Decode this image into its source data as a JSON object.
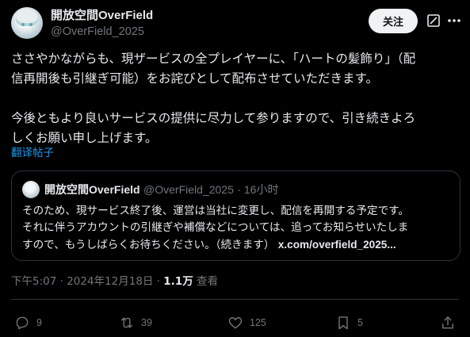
{
  "author": {
    "display_name": "開放空間OverField",
    "handle": "@OverField_2025"
  },
  "follow_label": "关注",
  "tweet": {
    "lines": [
      "ささやかながらも、現ザービスの全プレイヤーに、「ハートの髪飾り」（配",
      "信再開後も引継ぎ可能）をお詫びとして配布させていただきます。",
      "今後ともより良いサービスの提供に尽力して参りますので、引き続きよろ",
      "しくお願い申し上げます。"
    ]
  },
  "translate_label": "翻译帖子",
  "quote": {
    "display_name": "開放空間OverField",
    "handle": "@OverField_2025",
    "time": "16小时",
    "lines": [
      "そのため、現サービス終了後、運営は当社に変更し、配信を再開する予定です。",
      "それに伴うアカウントの引継ぎや補償などについては、追ってお知らせいたしま",
      "すので、もうしばらくお待ちください。（続きます）"
    ],
    "link": "x.com/overfield_2025..."
  },
  "timestamp": {
    "time": "下午5:07 · 2024年12月18日 · ",
    "views": "1.1万",
    "views_label": " 查看"
  },
  "actions": {
    "replies": "9",
    "reposts": "39",
    "likes": "125",
    "bookmarks": "5"
  },
  "icons": [
    "grok-icon",
    "more-icon",
    "reply-icon",
    "repost-icon",
    "like-icon",
    "bookmark-icon",
    "share-icon"
  ],
  "colors": {
    "background": "#000000",
    "text": "#e7e9ea",
    "secondary": "#71767b",
    "link": "#1d9bf0",
    "border": "#2f3336",
    "follow_bg": "#eff3f4"
  }
}
